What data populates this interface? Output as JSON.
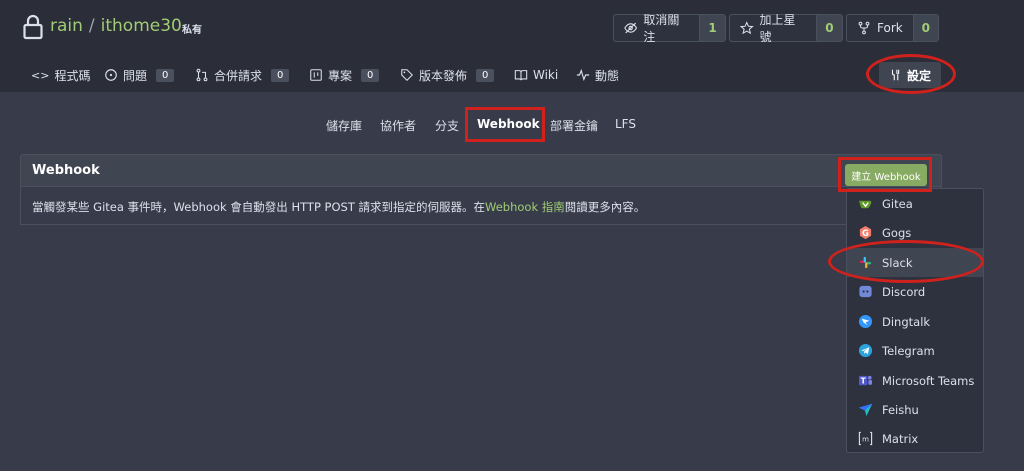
{
  "repo": {
    "owner": "rain",
    "separator": "/",
    "name": "ithome30",
    "private_label": "私有"
  },
  "actions": [
    {
      "label": "取消關注",
      "count": "1"
    },
    {
      "label": "加上星號",
      "count": "0"
    },
    {
      "label": "Fork",
      "count": "0"
    }
  ],
  "tabs": {
    "code": "程式碼",
    "issues": {
      "label": "問題",
      "count": "0"
    },
    "pulls": {
      "label": "合併請求",
      "count": "0"
    },
    "projects": {
      "label": "專案",
      "count": "0"
    },
    "releases": {
      "label": "版本發佈",
      "count": "0"
    },
    "wiki": "Wiki",
    "activity": "動態",
    "settings": "設定"
  },
  "subnav": [
    "儲存庫",
    "協作者",
    "分支",
    "Webhook",
    "部署金鑰",
    "LFS"
  ],
  "panel": {
    "title": "Webhook",
    "create_button": "建立 Webhook",
    "desc_prefix": "當觸發某些 Gitea 事件時，Webhook 會自動發出 HTTP POST 請求到指定的伺服器。在",
    "desc_link": "Webhook 指南",
    "desc_suffix": "閱讀更多內容。"
  },
  "dropdown": [
    "Gitea",
    "Gogs",
    "Slack",
    "Discord",
    "Dingtalk",
    "Telegram",
    "Microsoft Teams",
    "Feishu",
    "Matrix"
  ],
  "colors": {
    "accent": "#a0cc75",
    "button": "#87ab63",
    "highlight": "#d0211c",
    "background": "#383c4a"
  }
}
